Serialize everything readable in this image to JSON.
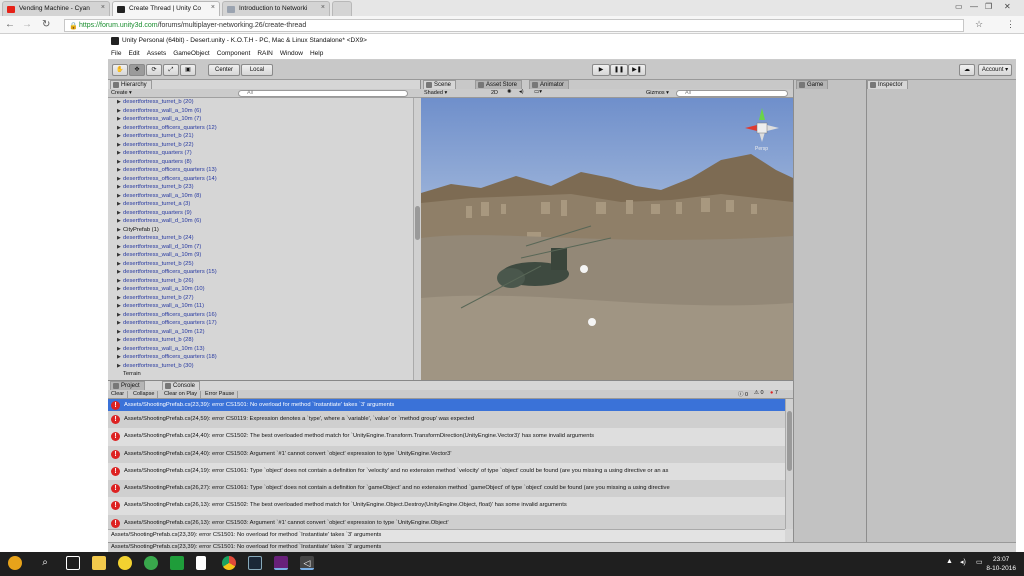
{
  "browser": {
    "tabs": [
      {
        "label": "Vending Machine - Cyan",
        "favicon_color": "#e62117"
      },
      {
        "label": "Create Thread | Unity Co",
        "favicon_color": "#222222"
      },
      {
        "label": "Introduction to Networki",
        "favicon_color": "#9aa3b0"
      }
    ],
    "url_host": "https://forum.unity3d.com",
    "url_path": "/forums/multiplayer-networking.26/create-thread"
  },
  "unity": {
    "title": "Unity Personal (64bit) - Desert.unity - K.O.T.H - PC, Mac & Linux Standalone* <DX9>",
    "menu": [
      "File",
      "Edit",
      "Assets",
      "GameObject",
      "Component",
      "RAIN",
      "Window",
      "Help"
    ],
    "toolbar": {
      "pivot_center": "Center",
      "pivot_local": "Local",
      "cloud_icon": "cloud-icon",
      "account": "Account"
    },
    "hierarchy": {
      "tab": "Hierarchy",
      "create": "Create",
      "search_placeholder": "All",
      "items": [
        "desertfortress_turret_b (20)",
        "desertfortress_wall_a_10m (6)",
        "desertfortress_wall_a_10m (7)",
        "desertfortress_officers_quarters (12)",
        "desertfortress_turret_b (21)",
        "desertfortress_turret_b (22)",
        "desertfortress_quarters (7)",
        "desertfortress_quarters (8)",
        "desertfortress_officers_quarters (13)",
        "desertfortress_officers_quarters (14)",
        "desertfortress_turret_b (23)",
        "desertfortress_wall_a_10m (8)",
        "desertfortress_turret_a (3)",
        "desertfortress_quarters (9)",
        "desertfortress_wall_d_10m (6)",
        "CityPrefab (1)",
        "desertfortress_turret_b (24)",
        "desertfortress_wall_d_10m (7)",
        "desertfortress_wall_a_10m (9)",
        "desertfortress_turret_b (25)",
        "desertfortress_officers_quarters (15)",
        "desertfortress_turret_b (26)",
        "desertfortress_wall_a_10m (10)",
        "desertfortress_turret_b (27)",
        "desertfortress_wall_a_10m (11)",
        "desertfortress_officers_quarters (16)",
        "desertfortress_officers_quarters (17)",
        "desertfortress_wall_a_10m (12)",
        "desertfortress_turret_b (28)",
        "desertfortress_wall_a_10m (13)",
        "desertfortress_officers_quarters (18)",
        "desertfortress_turret_b (30)",
        "Terrain"
      ]
    },
    "scene": {
      "tabs": [
        "Scene",
        "Asset Store",
        "Animator"
      ],
      "shading": "Shaded",
      "mode_2d": "2D",
      "gizmos": "Gizmos",
      "search_placeholder": "All",
      "persp_label": "Persp"
    },
    "right_tabs": {
      "game": "Game",
      "inspector": "Inspector"
    },
    "bottom_tabs": {
      "project": "Project",
      "console": "Console"
    },
    "console": {
      "buttons": [
        "Clear",
        "Collapse",
        "Clear on Play",
        "Error Pause"
      ],
      "counts": [
        "0",
        "0",
        "7"
      ],
      "messages": [
        "Assets/ShootingPrefab.cs(23,39): error CS1501: No overload for method `Instantiate' takes `3' arguments",
        "Assets/ShootingPrefab.cs(24,59): error CS0119: Expression denotes a `type', where a `variable', `value' or `method group' was expected",
        "Assets/ShootingPrefab.cs(24,40): error CS1502: The best overloaded method match for `UnityEngine.Transform.TransformDirection(UnityEngine.Vector3)' has some invalid arguments",
        "Assets/ShootingPrefab.cs(24,40): error CS1503: Argument `#1' cannot convert `object' expression to type `UnityEngine.Vector3'",
        "Assets/ShootingPrefab.cs(24,19): error CS1061: Type `object' does not contain a definition for `velocity' and no extension method `velocity' of type `object' could be found (are you missing a using directive or an as",
        "Assets/ShootingPrefab.cs(26,27): error CS1061: Type `object' does not contain a definition for `gameObject' and no extension method `gameObject' of type `object' could be found (are you missing a using directive",
        "Assets/ShootingPrefab.cs(26,13): error CS1502: The best overloaded method match for `UnityEngine.Object.Destroy(UnityEngine.Object, float)' has some invalid arguments",
        "Assets/ShootingPrefab.cs(26,13): error CS1503: Argument `#1' cannot convert `object' expression to type `UnityEngine.Object'"
      ],
      "detail": "Assets/ShootingPrefab.cs(23,39): error CS1501: No overload for method `Instantiate' takes `3' arguments"
    },
    "status_bar": "Assets/ShootingPrefab.cs(23,39): error CS1501: No overload for method `Instantiate' takes `3' arguments"
  },
  "taskbar": {
    "time": "23:07",
    "date": "8-10-2016",
    "icons": [
      "windows-start-icon",
      "search-icon",
      "file-explorer-icon",
      "norton-icon",
      "evernote-icon",
      "file-icon",
      "file-icon",
      "chrome-icon",
      "steam-icon",
      "visual-studio-icon",
      "unity-icon"
    ]
  }
}
